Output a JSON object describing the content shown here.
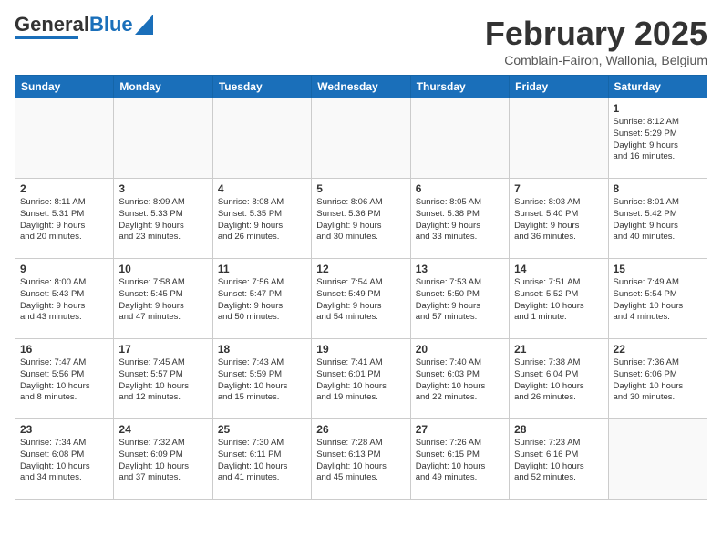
{
  "header": {
    "logo_line1": "General",
    "logo_line2": "Blue",
    "month_year": "February 2025",
    "location": "Comblain-Fairon, Wallonia, Belgium"
  },
  "weekdays": [
    "Sunday",
    "Monday",
    "Tuesday",
    "Wednesday",
    "Thursday",
    "Friday",
    "Saturday"
  ],
  "weeks": [
    [
      {
        "day": "",
        "info": ""
      },
      {
        "day": "",
        "info": ""
      },
      {
        "day": "",
        "info": ""
      },
      {
        "day": "",
        "info": ""
      },
      {
        "day": "",
        "info": ""
      },
      {
        "day": "",
        "info": ""
      },
      {
        "day": "1",
        "info": "Sunrise: 8:12 AM\nSunset: 5:29 PM\nDaylight: 9 hours\nand 16 minutes."
      }
    ],
    [
      {
        "day": "2",
        "info": "Sunrise: 8:11 AM\nSunset: 5:31 PM\nDaylight: 9 hours\nand 20 minutes."
      },
      {
        "day": "3",
        "info": "Sunrise: 8:09 AM\nSunset: 5:33 PM\nDaylight: 9 hours\nand 23 minutes."
      },
      {
        "day": "4",
        "info": "Sunrise: 8:08 AM\nSunset: 5:35 PM\nDaylight: 9 hours\nand 26 minutes."
      },
      {
        "day": "5",
        "info": "Sunrise: 8:06 AM\nSunset: 5:36 PM\nDaylight: 9 hours\nand 30 minutes."
      },
      {
        "day": "6",
        "info": "Sunrise: 8:05 AM\nSunset: 5:38 PM\nDaylight: 9 hours\nand 33 minutes."
      },
      {
        "day": "7",
        "info": "Sunrise: 8:03 AM\nSunset: 5:40 PM\nDaylight: 9 hours\nand 36 minutes."
      },
      {
        "day": "8",
        "info": "Sunrise: 8:01 AM\nSunset: 5:42 PM\nDaylight: 9 hours\nand 40 minutes."
      }
    ],
    [
      {
        "day": "9",
        "info": "Sunrise: 8:00 AM\nSunset: 5:43 PM\nDaylight: 9 hours\nand 43 minutes."
      },
      {
        "day": "10",
        "info": "Sunrise: 7:58 AM\nSunset: 5:45 PM\nDaylight: 9 hours\nand 47 minutes."
      },
      {
        "day": "11",
        "info": "Sunrise: 7:56 AM\nSunset: 5:47 PM\nDaylight: 9 hours\nand 50 minutes."
      },
      {
        "day": "12",
        "info": "Sunrise: 7:54 AM\nSunset: 5:49 PM\nDaylight: 9 hours\nand 54 minutes."
      },
      {
        "day": "13",
        "info": "Sunrise: 7:53 AM\nSunset: 5:50 PM\nDaylight: 9 hours\nand 57 minutes."
      },
      {
        "day": "14",
        "info": "Sunrise: 7:51 AM\nSunset: 5:52 PM\nDaylight: 10 hours\nand 1 minute."
      },
      {
        "day": "15",
        "info": "Sunrise: 7:49 AM\nSunset: 5:54 PM\nDaylight: 10 hours\nand 4 minutes."
      }
    ],
    [
      {
        "day": "16",
        "info": "Sunrise: 7:47 AM\nSunset: 5:56 PM\nDaylight: 10 hours\nand 8 minutes."
      },
      {
        "day": "17",
        "info": "Sunrise: 7:45 AM\nSunset: 5:57 PM\nDaylight: 10 hours\nand 12 minutes."
      },
      {
        "day": "18",
        "info": "Sunrise: 7:43 AM\nSunset: 5:59 PM\nDaylight: 10 hours\nand 15 minutes."
      },
      {
        "day": "19",
        "info": "Sunrise: 7:41 AM\nSunset: 6:01 PM\nDaylight: 10 hours\nand 19 minutes."
      },
      {
        "day": "20",
        "info": "Sunrise: 7:40 AM\nSunset: 6:03 PM\nDaylight: 10 hours\nand 22 minutes."
      },
      {
        "day": "21",
        "info": "Sunrise: 7:38 AM\nSunset: 6:04 PM\nDaylight: 10 hours\nand 26 minutes."
      },
      {
        "day": "22",
        "info": "Sunrise: 7:36 AM\nSunset: 6:06 PM\nDaylight: 10 hours\nand 30 minutes."
      }
    ],
    [
      {
        "day": "23",
        "info": "Sunrise: 7:34 AM\nSunset: 6:08 PM\nDaylight: 10 hours\nand 34 minutes."
      },
      {
        "day": "24",
        "info": "Sunrise: 7:32 AM\nSunset: 6:09 PM\nDaylight: 10 hours\nand 37 minutes."
      },
      {
        "day": "25",
        "info": "Sunrise: 7:30 AM\nSunset: 6:11 PM\nDaylight: 10 hours\nand 41 minutes."
      },
      {
        "day": "26",
        "info": "Sunrise: 7:28 AM\nSunset: 6:13 PM\nDaylight: 10 hours\nand 45 minutes."
      },
      {
        "day": "27",
        "info": "Sunrise: 7:26 AM\nSunset: 6:15 PM\nDaylight: 10 hours\nand 49 minutes."
      },
      {
        "day": "28",
        "info": "Sunrise: 7:23 AM\nSunset: 6:16 PM\nDaylight: 10 hours\nand 52 minutes."
      },
      {
        "day": "",
        "info": ""
      }
    ]
  ]
}
